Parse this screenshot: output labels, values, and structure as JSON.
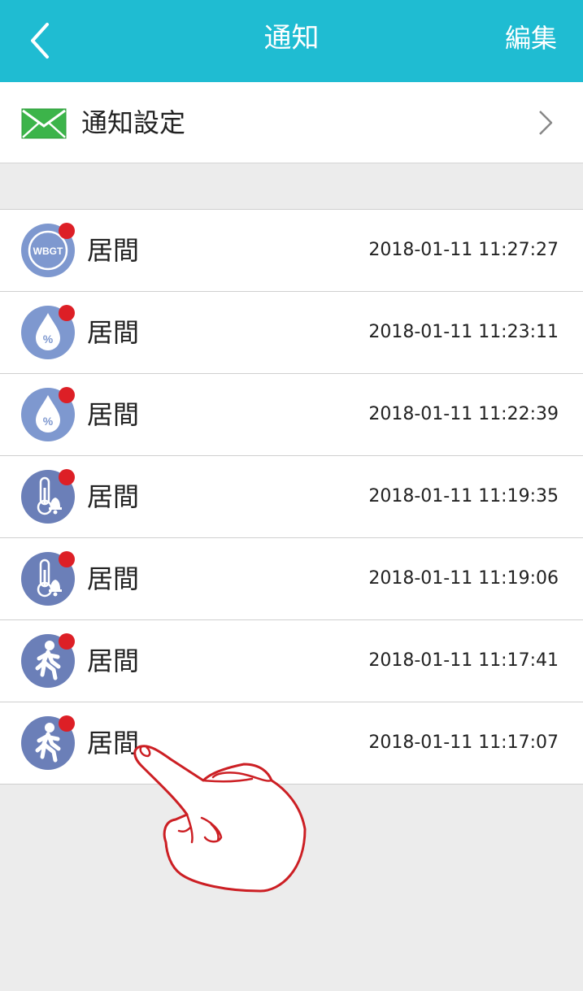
{
  "header": {
    "title": "通知",
    "edit_label": "編集",
    "bg_color": "#1fbcd2"
  },
  "settings": {
    "label": "通知設定",
    "icon": "mail-icon"
  },
  "notifications": [
    {
      "name": "居間",
      "time": "2018-01-11 11:27:27",
      "icon": "wbgt-icon",
      "icon_text": "WBGT"
    },
    {
      "name": "居間",
      "time": "2018-01-11 11:23:11",
      "icon": "humidity-icon",
      "icon_text": "%"
    },
    {
      "name": "居間",
      "time": "2018-01-11 11:22:39",
      "icon": "humidity-icon",
      "icon_text": "%"
    },
    {
      "name": "居間",
      "time": "2018-01-11 11:19:35",
      "icon": "temperature-alarm-icon"
    },
    {
      "name": "居間",
      "time": "2018-01-11 11:19:06",
      "icon": "temperature-alarm-icon"
    },
    {
      "name": "居間",
      "time": "2018-01-11 11:17:41",
      "icon": "motion-icon"
    },
    {
      "name": "居間",
      "time": "2018-01-11 11:17:07",
      "icon": "motion-icon"
    }
  ],
  "colors": {
    "badge": "#dd1f26",
    "icon_light": "#7e98cf",
    "icon_dark": "#6b7fb8",
    "hand_outline": "#cc1f24"
  }
}
